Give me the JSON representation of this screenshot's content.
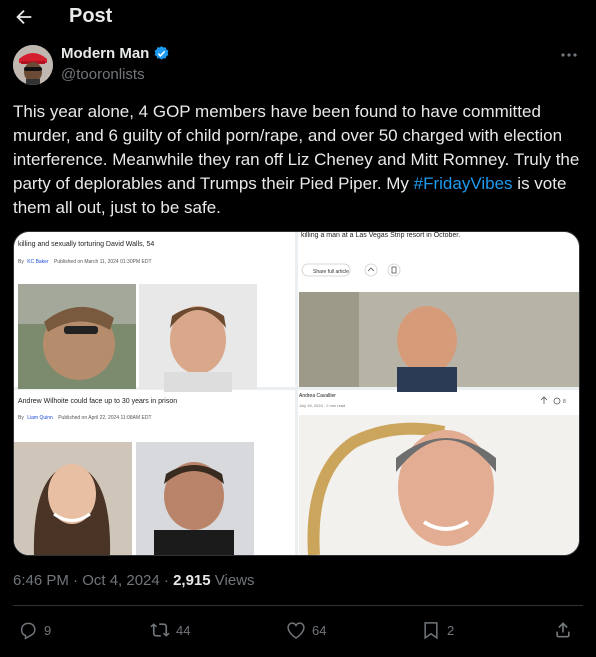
{
  "header": {
    "title": "Post"
  },
  "author": {
    "name": "Modern Man",
    "handle": "@tooronlists"
  },
  "post": {
    "text_before": "This year alone, 4 GOP members have been found to have committed murder, and 6 guilty of child porn/rape, and over 50 charged with election interference. Meanwhile they ran off Liz Cheney and Mitt Romney. Truly the party of deplorables and Trumps their Pied Piper. My ",
    "hashtag": "#FridayVibes",
    "text_after": " is vote them all out, just to be safe."
  },
  "media": {
    "top_left": {
      "headline": "killing and sexually torturing David Walls, 54",
      "byline_prefix": "By",
      "byline_author": "KC Baker",
      "byline_date": "Published on March 11, 2024 01:30PM EDT"
    },
    "bottom_left": {
      "headline": "Andrew Wilhoite could face up to 30 years in prison",
      "byline_prefix": "By",
      "byline_author": "Liam Quinn",
      "byline_date": "Published on April 22, 2024 11:08AM EDT"
    },
    "top_right": {
      "headline": "killing a man at a Las Vegas Strip resort in October.",
      "share_label": "Share full article"
    },
    "bottom_right": {
      "author": "Andrea Cavallier",
      "date": "July 16, 2024 · 2 min read",
      "comment_count": "8"
    }
  },
  "meta": {
    "time": "6:46 PM · Oct 4, 2024 · ",
    "views_count": "2,915",
    "views_label": " Views"
  },
  "actions": {
    "replies": "9",
    "reposts": "44",
    "likes": "64",
    "bookmarks": "2"
  },
  "colors": {
    "accent": "#1d9bf0",
    "muted": "#71767b",
    "text": "#e7e9ea",
    "background": "#000000"
  }
}
